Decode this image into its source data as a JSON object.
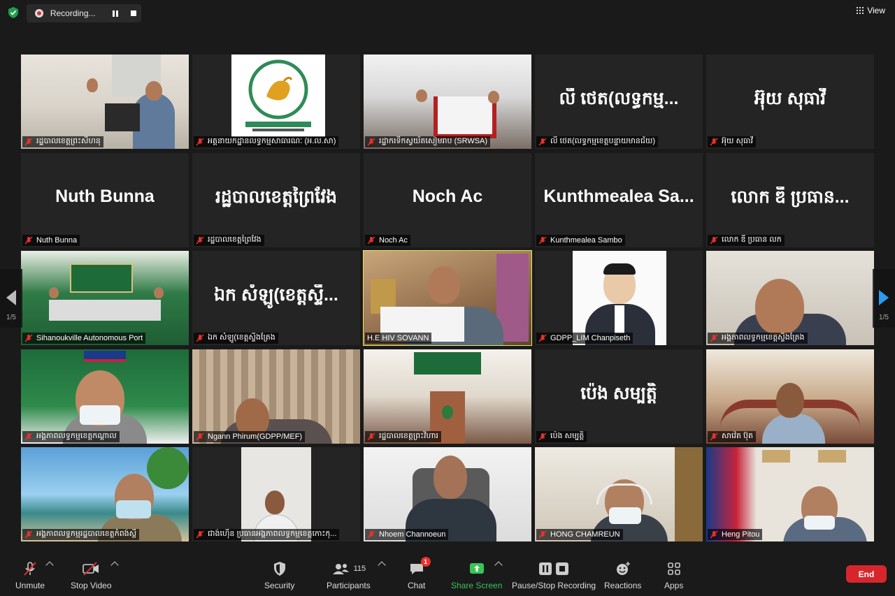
{
  "recording": {
    "label": "Recording..."
  },
  "view": {
    "label": "View"
  },
  "nav": {
    "left_page": "1/5",
    "right_page": "1/5"
  },
  "tiles": [
    {
      "name": "រដ្ឋបាលខេត្តព្រះសីហនុ",
      "big": ""
    },
    {
      "name": "អគ្គនាយកដ្ឋានលទ្ធកម្មសាធារណៈ (អ.ល.សា)",
      "big": ""
    },
    {
      "name": "រដ្ឋាករទឹកស្វយ័តសៀមរាប (SRWSA)",
      "big": ""
    },
    {
      "name": "លី ថេត(លទ្ធកម្មខេត្តបន្ទាយមានជ័យ)",
      "big": "លី ថេត(លទ្ធកម្ម..."
    },
    {
      "name": "អ៊ុយ សុធាវី",
      "big": "អ៊ុយ សុធាវី"
    },
    {
      "name": "Nuth Bunna",
      "big": "Nuth Bunna"
    },
    {
      "name": "រដ្ឋបាលខេត្តព្រៃវែង",
      "big": "រដ្ឋបាលខេត្តព្រៃវែង"
    },
    {
      "name": "Noch Ac",
      "big": "Noch Ac"
    },
    {
      "name": "Kunthmealea Sambo",
      "big": "Kunthmealea  Sa..."
    },
    {
      "name": "លោក ឌី ប្រធាន លក",
      "big": "លោក ឌី ប្រធាន..."
    },
    {
      "name": "Sihanoukville Autonomous Port",
      "big": ""
    },
    {
      "name": "ឯក សំឡូ(ខេត្តស្ទឹងត្រែង",
      "big": "ឯក សំឡូ(ខេត្តស្ទឹ..."
    },
    {
      "name": "H.E HIV SOVANN",
      "big": ""
    },
    {
      "name": "GDPP_LIM Chanpiseth",
      "big": ""
    },
    {
      "name": "អង្គភាពលទ្ធកម្មខេត្តស្ទឹងត្រែង",
      "big": ""
    },
    {
      "name": "អង្គភាពលទ្ធកម្មខេត្តកណ្តាល",
      "big": ""
    },
    {
      "name": "Ngann Phirum(GDPP/MEF)",
      "big": ""
    },
    {
      "name": "រដ្ឋបាលខេត្តព្រះវិហារ",
      "big": ""
    },
    {
      "name": "ប៉េង សម្បត្តិ",
      "big": "ប៉េង សម្បត្តិ"
    },
    {
      "name": "សាវ៉េត ប៊ុត",
      "big": ""
    },
    {
      "name": "អង្គភាពលទ្ធកម្មរដ្ឋបាលខេត្តកំពង់ស្ពឺ",
      "big": ""
    },
    {
      "name": "ជាង់ហ៊ើន ប្រធានអង្គភាពលទ្ធកម្មខេត្តកោះកុ...",
      "big": ""
    },
    {
      "name": "Nhoem Channoeun",
      "big": ""
    },
    {
      "name": "HONG CHAMREUN",
      "big": ""
    },
    {
      "name": "Heng Pitou",
      "big": ""
    }
  ],
  "toolbar": {
    "unmute": "Unmute",
    "stop_video": "Stop Video",
    "security": "Security",
    "participants": "Participants",
    "participant_count": "115",
    "chat": "Chat",
    "chat_badge": "1",
    "share_screen": "Share Screen",
    "pause_stop_recording": "Pause/Stop Recording",
    "reactions": "Reactions",
    "apps": "Apps",
    "end": "End"
  },
  "colors": {
    "active_speaker": "#e8e85a",
    "end_button": "#d7262b",
    "share_green": "#39c45a",
    "muted_red": "#e8322e",
    "next_arrow": "#2b9cf0"
  }
}
